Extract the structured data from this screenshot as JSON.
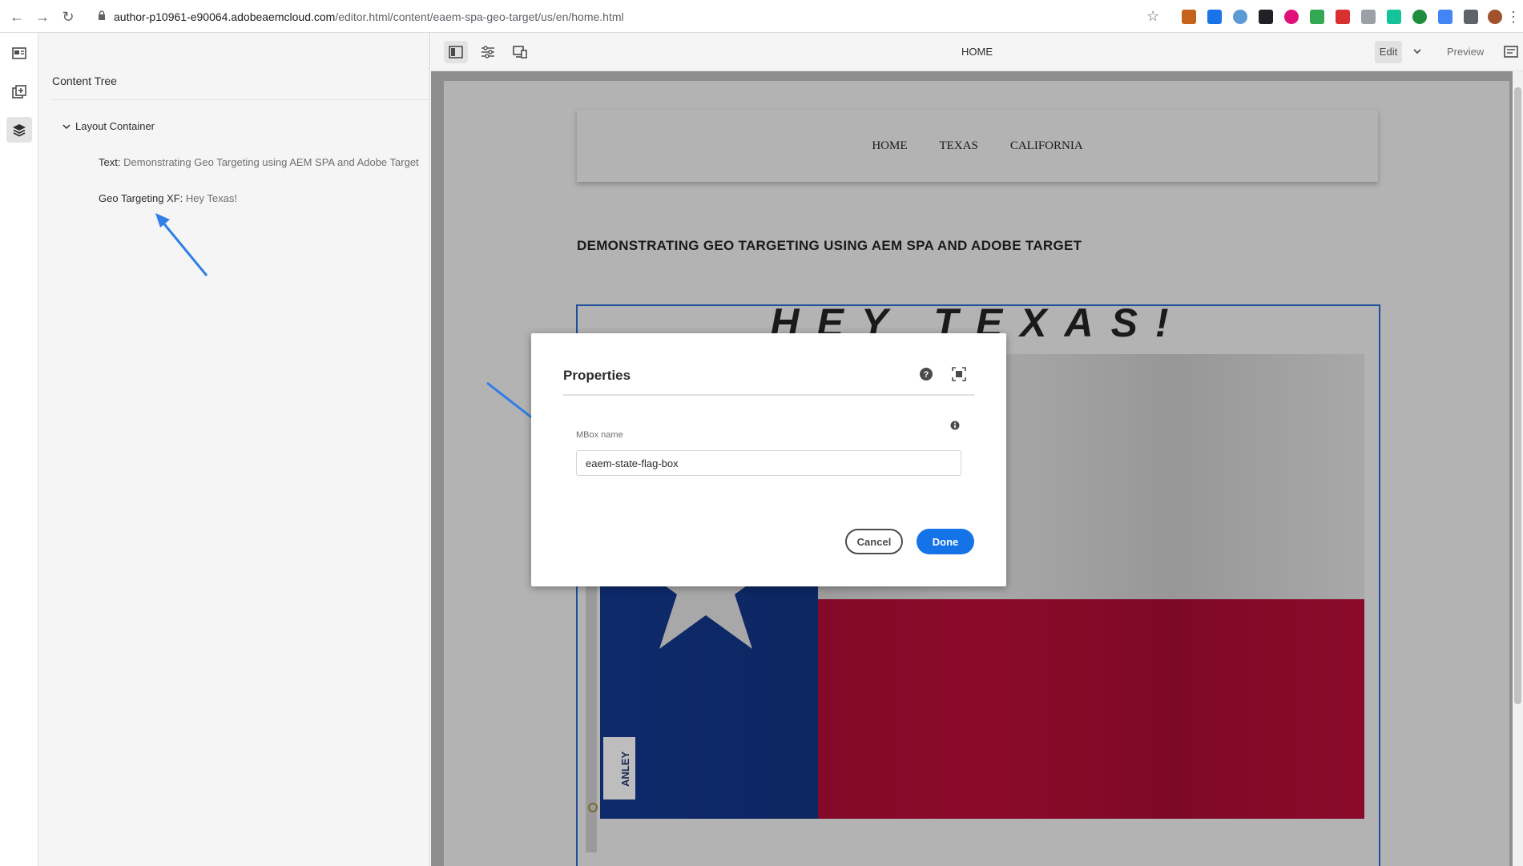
{
  "browser": {
    "url_host": "author-p10961-e90064.adobeaemcloud.com",
    "url_path": "/editor.html/content/eaem-spa-geo-target/us/en/home.html"
  },
  "left_rail": {
    "items": [
      "page-properties-icon",
      "components-icon",
      "content-tree-icon"
    ]
  },
  "content_tree": {
    "title": "Content Tree",
    "root": "Layout Container",
    "items": [
      {
        "type": "Text:",
        "value": "Demonstrating Geo Targeting using AEM SPA and Adobe Target"
      },
      {
        "type": "Geo Targeting XF:",
        "value": "Hey Texas!"
      }
    ]
  },
  "toolbar": {
    "title": "HOME",
    "mode": "Edit",
    "preview": "Preview"
  },
  "page": {
    "nav": [
      "HOME",
      "TEXAS",
      "CALIFORNIA"
    ],
    "heading": "DEMONSTRATING GEO TARGETING USING AEM SPA AND ADOBE TARGET",
    "xf_heading": "HEY TEXAS!",
    "flag_label": "ANLEY"
  },
  "dialog": {
    "title": "Properties",
    "field_label": "MBox name",
    "field_value": "eaem-state-flag-box",
    "cancel_label": "Cancel",
    "done_label": "Done"
  },
  "colors": {
    "accent": "#1473e6",
    "annotation_arrow": "#2f7fe8",
    "flag_blue": "#0e2a6b",
    "flag_red": "#8b0a2a"
  }
}
